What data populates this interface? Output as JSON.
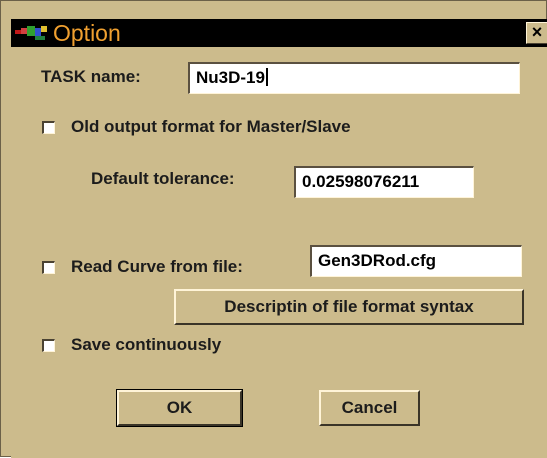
{
  "window": {
    "title": "Option",
    "close_glyph": "×"
  },
  "task": {
    "label": "TASK name:",
    "value": "Nu3D-19"
  },
  "old_output": {
    "label": "Old output format for Master/Slave",
    "checked": false
  },
  "tolerance": {
    "label": "Default tolerance:",
    "value": "0.02598076211"
  },
  "read_curve": {
    "label": "Read Curve from file:",
    "checked": false,
    "value": "Gen3DRod.cfg"
  },
  "format_button": {
    "label": "Descriptin of file format syntax"
  },
  "save_continuously": {
    "label": "Save continuously",
    "checked": false
  },
  "buttons": {
    "ok": "OK",
    "cancel": "Cancel"
  },
  "colors": {
    "face": "#ccbb8c",
    "titlebar": "#000000",
    "title_text": "#f0a030"
  },
  "icons": {
    "app": "app-logo-icon",
    "close": "close-icon"
  }
}
